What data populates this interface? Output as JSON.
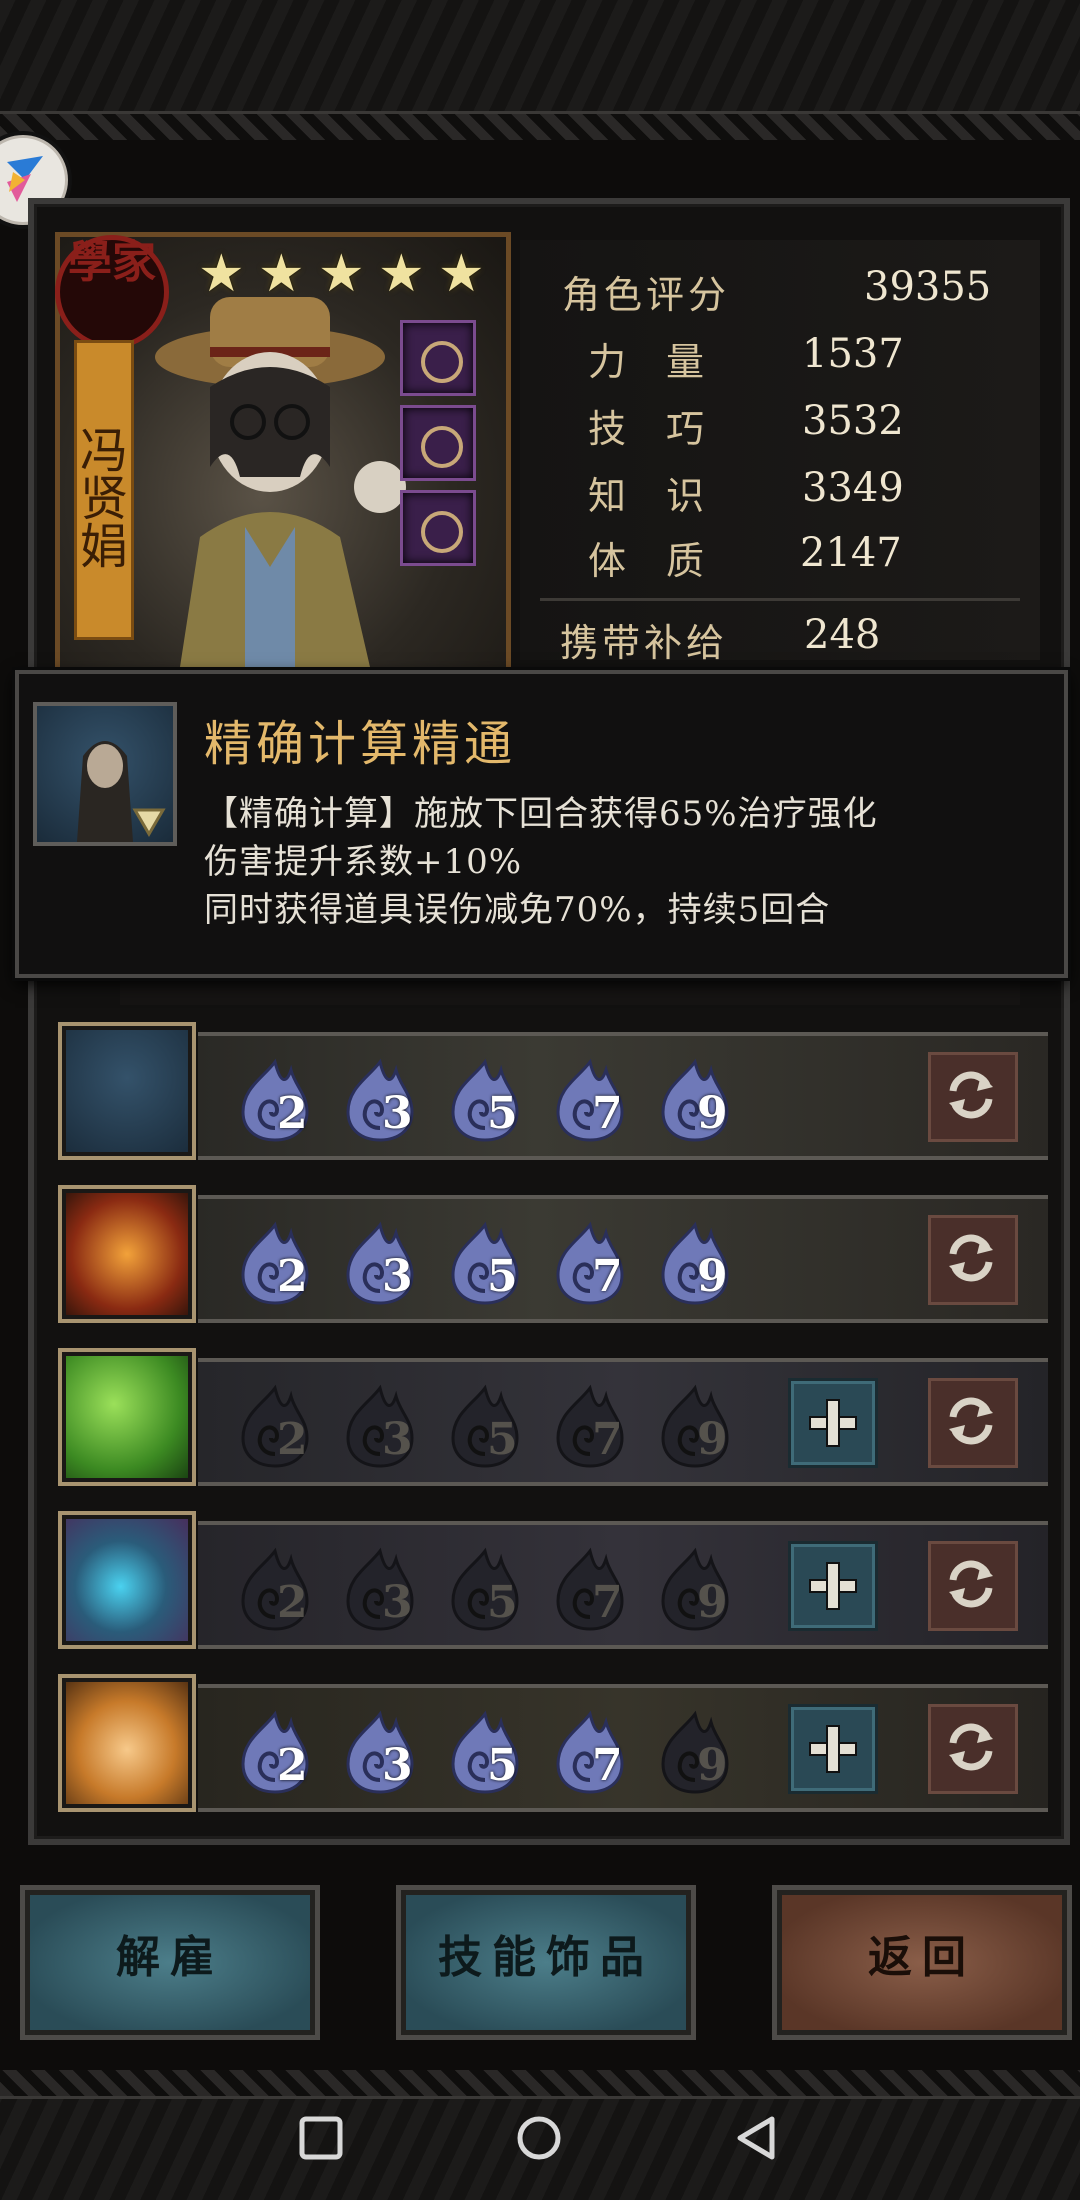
{
  "hero": {
    "class_seal": "學家",
    "name": "冯贤娟",
    "stars": 5
  },
  "stats": [
    {
      "label": "角色评分",
      "value": "39355"
    },
    {
      "label": "力量",
      "value": "1537"
    },
    {
      "label": "技巧",
      "value": "3532"
    },
    {
      "label": "知识",
      "value": "3349"
    },
    {
      "label": "体质",
      "value": "2147"
    },
    {
      "label": "携带补给",
      "value": "248"
    }
  ],
  "tooltip": {
    "title": "精确计算精通",
    "lines": [
      "【精确计算】施放下回合获得65%治疗强化",
      "伤害提升系数+10%",
      "同时获得道具误伤减免70%，持续5回合"
    ]
  },
  "skills": [
    {
      "levels": [
        "2",
        "3",
        "5",
        "7",
        "9"
      ],
      "unlocked": 5,
      "has_plus": false
    },
    {
      "levels": [
        "2",
        "3",
        "5",
        "7",
        "9"
      ],
      "unlocked": 5,
      "has_plus": false
    },
    {
      "levels": [
        "2",
        "3",
        "5",
        "7",
        "9"
      ],
      "unlocked": 0,
      "has_plus": true
    },
    {
      "levels": [
        "2",
        "3",
        "5",
        "7",
        "9"
      ],
      "unlocked": 0,
      "has_plus": true
    },
    {
      "levels": [
        "2",
        "3",
        "5",
        "7",
        "9"
      ],
      "unlocked": 4,
      "has_plus": true
    }
  ],
  "buttons": {
    "dismiss": "解雇",
    "skill_trinket": "技能饰品",
    "back": "返回"
  },
  "icons": [
    "square-nav-icon",
    "circle-nav-icon",
    "back-nav-icon",
    "plus-icon",
    "swap-icon",
    "flame-icon",
    "star-icon"
  ]
}
